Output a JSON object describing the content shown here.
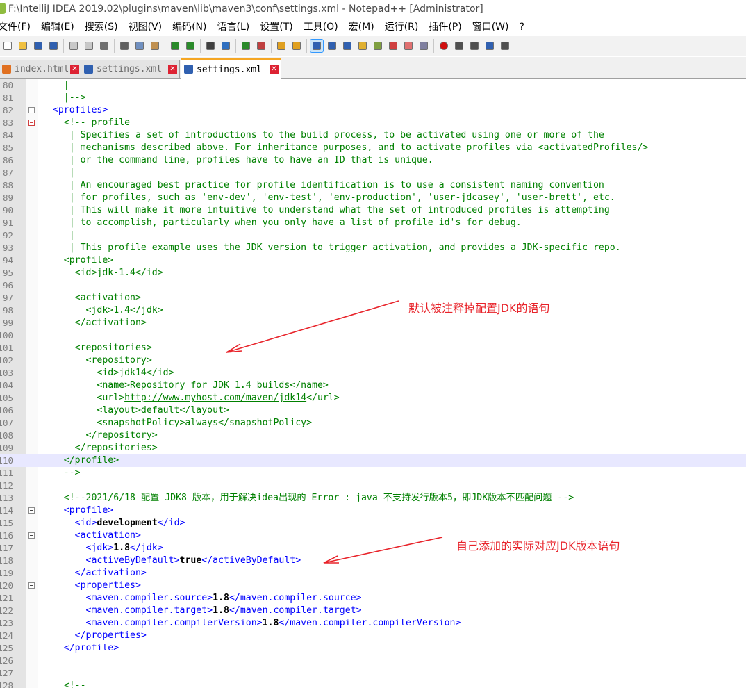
{
  "window": {
    "title": "F:\\IntelliJ IDEA 2019.02\\plugins\\maven\\lib\\maven3\\conf\\settings.xml - Notepad++ [Administrator]"
  },
  "menu": [
    "文件(F)",
    "编辑(E)",
    "搜索(S)",
    "视图(V)",
    "编码(N)",
    "语言(L)",
    "设置(T)",
    "工具(O)",
    "宏(M)",
    "运行(R)",
    "插件(P)",
    "窗口(W)",
    "?"
  ],
  "toolbar": {
    "icons": [
      "new-file-icon",
      "open-file-icon",
      "save-icon",
      "save-all-icon",
      "close-icon",
      "close-all-icon",
      "print-icon",
      "cut-icon",
      "copy-icon",
      "paste-icon",
      "undo-icon",
      "redo-icon",
      "find-icon",
      "replace-icon",
      "zoom-in-icon",
      "zoom-out-icon",
      "sync-vertical-icon",
      "sync-horizontal-icon",
      "word-wrap-icon",
      "show-all-chars-icon",
      "indent-guide-icon",
      "language-icon",
      "doc-map-icon",
      "function-list-icon",
      "folder-workspace-icon",
      "monitor-icon",
      "record-macro-icon",
      "stop-record-icon",
      "play-macro-icon",
      "run-macro-multiple-icon",
      "save-macro-icon"
    ],
    "colors": {
      "record": "#d01010",
      "active_border": "#3399ff"
    }
  },
  "tabs": [
    {
      "label": "index.html",
      "active": false
    },
    {
      "label": "settings.xml",
      "active": false
    },
    {
      "label": "settings.xml",
      "active": true
    }
  ],
  "editor": {
    "lines": [
      {
        "n": "80",
        "fold": "",
        "segs": [
          {
            "c": "c",
            "t": "    |"
          }
        ]
      },
      {
        "n": "81",
        "fold": "",
        "segs": [
          {
            "c": "c",
            "t": "    |-->"
          }
        ]
      },
      {
        "n": "82",
        "fold": "box",
        "segs": [
          {
            "c": "t",
            "t": "  <profiles>"
          }
        ]
      },
      {
        "n": "83",
        "fold": "boxred",
        "segs": [
          {
            "c": "c",
            "t": "    <!-- profile"
          }
        ]
      },
      {
        "n": "84",
        "fold": "",
        "segs": [
          {
            "c": "c",
            "t": "     | Specifies a set of introductions to the build process, to be activated using one or more of the"
          }
        ]
      },
      {
        "n": "85",
        "fold": "",
        "segs": [
          {
            "c": "c",
            "t": "     | mechanisms described above. For inheritance purposes, and to activate profiles via <activatedProfiles/>"
          }
        ]
      },
      {
        "n": "86",
        "fold": "",
        "segs": [
          {
            "c": "c",
            "t": "     | or the command line, profiles have to have an ID that is unique."
          }
        ]
      },
      {
        "n": "87",
        "fold": "",
        "segs": [
          {
            "c": "c",
            "t": "     |"
          }
        ]
      },
      {
        "n": "88",
        "fold": "",
        "segs": [
          {
            "c": "c",
            "t": "     | An encouraged best practice for profile identification is to use a consistent naming convention"
          }
        ]
      },
      {
        "n": "89",
        "fold": "",
        "segs": [
          {
            "c": "c",
            "t": "     | for profiles, such as 'env-dev', 'env-test', 'env-production', 'user-jdcasey', 'user-brett', etc."
          }
        ]
      },
      {
        "n": "90",
        "fold": "",
        "segs": [
          {
            "c": "c",
            "t": "     | This will make it more intuitive to understand what the set of introduced profiles is attempting"
          }
        ]
      },
      {
        "n": "91",
        "fold": "",
        "segs": [
          {
            "c": "c",
            "t": "     | to accomplish, particularly when you only have a list of profile id's for debug."
          }
        ]
      },
      {
        "n": "92",
        "fold": "",
        "segs": [
          {
            "c": "c",
            "t": "     |"
          }
        ]
      },
      {
        "n": "93",
        "fold": "",
        "segs": [
          {
            "c": "c",
            "t": "     | This profile example uses the JDK version to trigger activation, and provides a JDK-specific repo."
          }
        ]
      },
      {
        "n": "94",
        "fold": "",
        "segs": [
          {
            "c": "c",
            "t": "    <profile>"
          }
        ]
      },
      {
        "n": "95",
        "fold": "",
        "segs": [
          {
            "c": "c",
            "t": "      <id>jdk-1.4</id>"
          }
        ]
      },
      {
        "n": "96",
        "fold": "",
        "segs": [
          {
            "c": "c",
            "t": ""
          }
        ]
      },
      {
        "n": "97",
        "fold": "",
        "segs": [
          {
            "c": "c",
            "t": "      <activation>"
          }
        ]
      },
      {
        "n": "98",
        "fold": "",
        "segs": [
          {
            "c": "c",
            "t": "        <jdk>1.4</jdk>"
          }
        ]
      },
      {
        "n": "99",
        "fold": "",
        "segs": [
          {
            "c": "c",
            "t": "      </activation>"
          }
        ]
      },
      {
        "n": "100",
        "fold": "",
        "segs": [
          {
            "c": "c",
            "t": ""
          }
        ]
      },
      {
        "n": "101",
        "fold": "",
        "segs": [
          {
            "c": "c",
            "t": "      <repositories>"
          }
        ]
      },
      {
        "n": "102",
        "fold": "",
        "segs": [
          {
            "c": "c",
            "t": "        <repository>"
          }
        ]
      },
      {
        "n": "103",
        "fold": "",
        "segs": [
          {
            "c": "c",
            "t": "          <id>jdk14</id>"
          }
        ]
      },
      {
        "n": "104",
        "fold": "",
        "segs": [
          {
            "c": "c",
            "t": "          <name>Repository for JDK 1.4 builds</name>"
          }
        ]
      },
      {
        "n": "105",
        "fold": "",
        "segs": [
          {
            "c": "c",
            "t": "          <url>"
          },
          {
            "c": "c ul",
            "t": "http://www.myhost.com/maven/jdk14"
          },
          {
            "c": "c",
            "t": "</url>"
          }
        ]
      },
      {
        "n": "106",
        "fold": "",
        "segs": [
          {
            "c": "c",
            "t": "          <layout>default</layout>"
          }
        ]
      },
      {
        "n": "107",
        "fold": "",
        "segs": [
          {
            "c": "c",
            "t": "          <snapshotPolicy>always</snapshotPolicy>"
          }
        ]
      },
      {
        "n": "108",
        "fold": "",
        "segs": [
          {
            "c": "c",
            "t": "        </repository>"
          }
        ]
      },
      {
        "n": "109",
        "fold": "",
        "segs": [
          {
            "c": "c",
            "t": "      </repositories>"
          }
        ]
      },
      {
        "n": "110",
        "fold": "",
        "hl": true,
        "segs": [
          {
            "c": "c",
            "t": "    </profile>"
          }
        ]
      },
      {
        "n": "111",
        "fold": "",
        "segs": [
          {
            "c": "c",
            "t": "    -->"
          }
        ]
      },
      {
        "n": "112",
        "fold": "",
        "segs": [
          {
            "c": "c",
            "t": ""
          }
        ]
      },
      {
        "n": "113",
        "fold": "",
        "segs": [
          {
            "c": "c",
            "t": "    <!--2021/6/18 配置 JDK8 版本，用于解决idea出现的 Error : java 不支持发行版本5，即JDK版本不匹配问题 -->"
          }
        ]
      },
      {
        "n": "114",
        "fold": "box",
        "segs": [
          {
            "c": "t",
            "t": "    <profile>"
          }
        ]
      },
      {
        "n": "115",
        "fold": "",
        "segs": [
          {
            "c": "t",
            "t": "      <id>"
          },
          {
            "c": "v",
            "t": "development"
          },
          {
            "c": "t",
            "t": "</id>"
          }
        ]
      },
      {
        "n": "116",
        "fold": "box",
        "segs": [
          {
            "c": "t",
            "t": "      <activation>"
          }
        ]
      },
      {
        "n": "117",
        "fold": "",
        "segs": [
          {
            "c": "t",
            "t": "        <jdk>"
          },
          {
            "c": "v",
            "t": "1.8"
          },
          {
            "c": "t",
            "t": "</jdk>"
          }
        ]
      },
      {
        "n": "118",
        "fold": "",
        "segs": [
          {
            "c": "t",
            "t": "        <activeByDefault>"
          },
          {
            "c": "v",
            "t": "true"
          },
          {
            "c": "t",
            "t": "</activeByDefault>"
          }
        ]
      },
      {
        "n": "119",
        "fold": "",
        "segs": [
          {
            "c": "t",
            "t": "      </activation>"
          }
        ]
      },
      {
        "n": "120",
        "fold": "box",
        "segs": [
          {
            "c": "t",
            "t": "      <properties>"
          }
        ]
      },
      {
        "n": "121",
        "fold": "",
        "segs": [
          {
            "c": "t",
            "t": "        <maven.compiler.source>"
          },
          {
            "c": "v",
            "t": "1.8"
          },
          {
            "c": "t",
            "t": "</maven.compiler.source>"
          }
        ]
      },
      {
        "n": "122",
        "fold": "",
        "segs": [
          {
            "c": "t",
            "t": "        <maven.compiler.target>"
          },
          {
            "c": "v",
            "t": "1.8"
          },
          {
            "c": "t",
            "t": "</maven.compiler.target>"
          }
        ]
      },
      {
        "n": "123",
        "fold": "",
        "segs": [
          {
            "c": "t",
            "t": "        <maven.compiler.compilerVersion>"
          },
          {
            "c": "v",
            "t": "1.8"
          },
          {
            "c": "t",
            "t": "</maven.compiler.compilerVersion>"
          }
        ]
      },
      {
        "n": "124",
        "fold": "",
        "segs": [
          {
            "c": "t",
            "t": "      </properties>"
          }
        ]
      },
      {
        "n": "125",
        "fold": "",
        "segs": [
          {
            "c": "t",
            "t": "    </profile>"
          }
        ]
      },
      {
        "n": "126",
        "fold": "",
        "segs": [
          {
            "c": "c",
            "t": ""
          }
        ]
      },
      {
        "n": "127",
        "fold": "",
        "segs": [
          {
            "c": "c",
            "t": ""
          }
        ]
      },
      {
        "n": "128",
        "fold": "",
        "segs": [
          {
            "c": "c",
            "t": "    <!--"
          }
        ]
      }
    ]
  },
  "annotations": {
    "commented_default": "默认被注释掉配置JDK的语句",
    "added_actual": "自己添加的实际对应JDK版本语句",
    "color": "#e8232a"
  }
}
